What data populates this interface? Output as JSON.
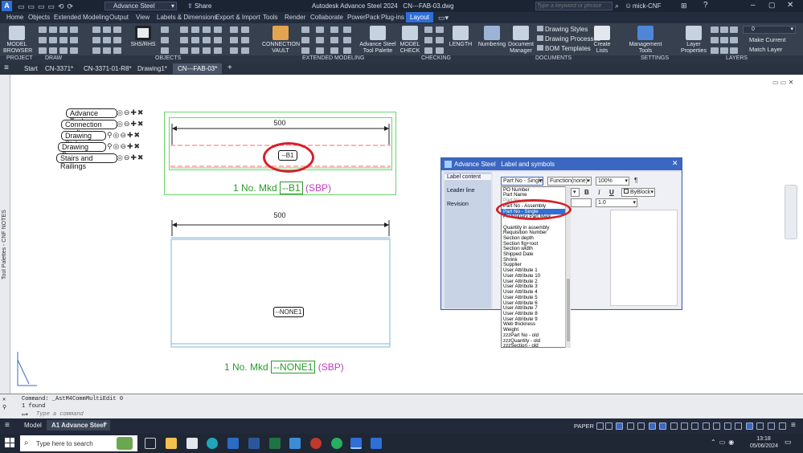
{
  "title_bar": {
    "workspace": "Advance Steel",
    "share_label": "Share",
    "app_title": "Autodesk Advance Steel 2024",
    "document_title": "CN---FAB-03.dwg",
    "search_placeholder": "Type a keyword or phrase",
    "user": "mick-CNF"
  },
  "ribbon_tabs": [
    "Home",
    "Objects",
    "Extended Modeling",
    "Output",
    "View",
    "Labels & Dimensions",
    "Export & Import",
    "Tools",
    "Render",
    "Collaborate",
    "PowerPack",
    "Plug-ins",
    "Layout"
  ],
  "ribbon_active_tab": "Layout",
  "ribbon_buttons": {
    "model_browser": "MODEL BROWSER",
    "shs_rhs": "SHS/RHS",
    "connection_vault": "CONNECTION VAULT",
    "tool_palette": "Advance Steel Tool Palette",
    "model_check": "MODEL CHECK",
    "length": "LENGTH",
    "numbering": "Numbering",
    "document_manager": "Document Manager",
    "drawing_styles": "Drawing Styles",
    "drawing_processes": "Drawing Processes",
    "bom_templates": "BOM Templates",
    "create_lists": "Create Lists",
    "management_tools": "Management Tools",
    "layer_properties": "Layer Properties",
    "make_current": "Make Current",
    "match_layer": "Match Layer",
    "layer_value": "0"
  },
  "panel_labels": [
    "PROJECT",
    "DRAW",
    "OBJECTS",
    "EXTENDED MODELING",
    "CHECKING",
    "DOCUMENTS",
    "SETTINGS",
    "LAYERS"
  ],
  "doc_tabs": [
    "Start",
    "CN-3371*",
    "CN-3371-01-R8*",
    "Drawing1*",
    "CN---FAB-03*"
  ],
  "active_doc_tab": "CN---FAB-03*",
  "palette_side_label": "Tool Palettes - CNF NOTES",
  "palette_items": [
    "Advance Tool...",
    "Connection vault",
    "Drawing Styl...",
    "Drawing Proc...",
    "Stairs and Railings"
  ],
  "drawing": {
    "dim_top": "500",
    "mark_top": "--B1",
    "caption_top_prefix": "1 No. Mkd",
    "caption_top_mark": "--B1",
    "caption_top_suffix": "(SBP)",
    "dim_bottom": "500",
    "mark_bottom": "--NONE1",
    "caption_bottom_prefix": "1 No. Mkd",
    "caption_bottom_mark": "--NONE1",
    "caption_bottom_suffix": "(SBP)"
  },
  "dialog": {
    "app": "Advance Steel",
    "title": "Label and symbols",
    "nav": [
      "Label content",
      "Leader line",
      "Revision"
    ],
    "content_select": "Part No - Single",
    "function_select": "Function(none)",
    "zoom_select": "100%",
    "para_symbol": "¶",
    "bold": "B",
    "italic": "I",
    "underline": "U",
    "color_select": "ByBlock",
    "height_select": "1.0",
    "dropdown_items": [
      "PO Number",
      "Part Name",
      "Part No",
      "Part No - Assembly",
      "Part No - Single",
      "Preliminary Part Mark",
      "Quantity in assembly",
      "Requisition Number",
      "Section depth",
      "Section flg+root",
      "Section width",
      "Shipped Date",
      "Shrink",
      "Supplier",
      "User Attribute 1",
      "User Attribute 10",
      "User Attribute 2",
      "User Attribute 3",
      "User Attribute 4",
      "User Attribute 5",
      "User Attribute 6",
      "User Attribute 7",
      "User Attribute 8",
      "User Attribute 9",
      "Web thickness",
      "Weight",
      "zzzPart No - old",
      "zzzQuantity - old",
      "zzzSection - old"
    ],
    "dropdown_selected": "Part No - Single"
  },
  "command_line": {
    "line1": "Command: _AstM4CommMultiEdit 0",
    "line2": "1 found",
    "placeholder": "Type a command"
  },
  "layout_tabs": [
    "Model",
    "A1 Advance Steel"
  ],
  "status_bar": {
    "paper": "PAPER"
  },
  "taskbar": {
    "search_placeholder": "Type here to search",
    "time": "13:18",
    "date": "05/06/2024"
  },
  "colors": {
    "accent": "#2f6fd6",
    "highlight_red": "#d6202a",
    "frame_green": "#6bd66b",
    "caption_green": "#2a9a2a",
    "caption_magenta": "#c23cc2"
  }
}
